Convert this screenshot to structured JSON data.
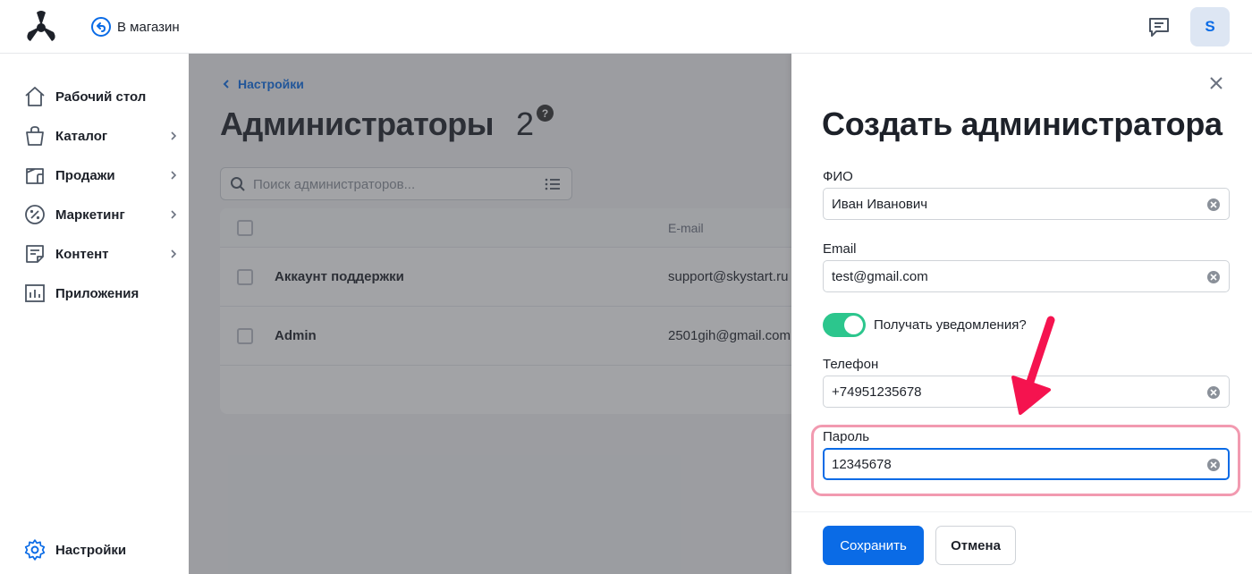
{
  "topbar": {
    "to_store_label": "В магазин",
    "avatar_initial": "S"
  },
  "sidebar": {
    "items": [
      {
        "label": "Рабочий стол",
        "icon": "home-icon",
        "has_submenu": false
      },
      {
        "label": "Каталог",
        "icon": "bag-icon",
        "has_submenu": true
      },
      {
        "label": "Продажи",
        "icon": "sales-icon",
        "has_submenu": true
      },
      {
        "label": "Маркетинг",
        "icon": "percent-icon",
        "has_submenu": true
      },
      {
        "label": "Контент",
        "icon": "content-icon",
        "has_submenu": true
      },
      {
        "label": "Приложения",
        "icon": "chart-icon",
        "has_submenu": false
      }
    ],
    "settings_label": "Настройки"
  },
  "main": {
    "breadcrumb": "Настройки",
    "title": "Администраторы",
    "count": "2",
    "help": "?",
    "search_placeholder": "Поиск администраторов...",
    "table": {
      "email_header": "E-mail",
      "rows": [
        {
          "name": "Аккаунт поддержки",
          "email": "support@skystart.ru"
        },
        {
          "name": "Admin",
          "email": "2501gih@gmail.com"
        }
      ]
    }
  },
  "drawer": {
    "title": "Создать администратора",
    "fields": {
      "fio": {
        "label": "ФИО",
        "value": "Иван Иванович"
      },
      "email": {
        "label": "Email",
        "value": "test@gmail.com"
      },
      "notify": {
        "label": "Получать уведомления?",
        "enabled": true
      },
      "phone": {
        "label": "Телефон",
        "value": "+74951235678"
      },
      "password": {
        "label": "Пароль",
        "value": "12345678"
      }
    },
    "save_label": "Сохранить",
    "cancel_label": "Отмена"
  },
  "colors": {
    "accent": "#0a6be6",
    "toggle_on": "#2cc68d",
    "highlight": "#f29ab0",
    "arrow": "#f5134f"
  }
}
